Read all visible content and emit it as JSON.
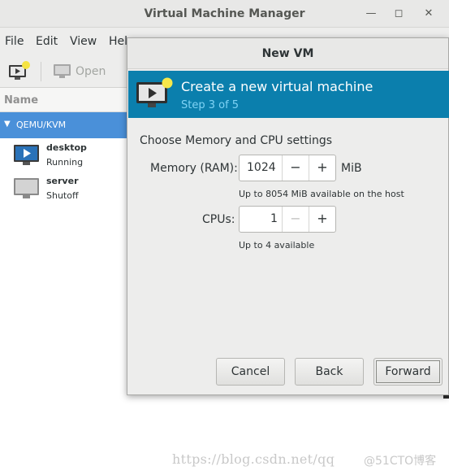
{
  "main_window": {
    "title": "Virtual Machine Manager",
    "controls": {
      "minimize": "—",
      "maximize": "◻",
      "close": "✕"
    },
    "menu": [
      "File",
      "Edit",
      "View",
      "Hel"
    ],
    "toolbar": {
      "open_label": "Open"
    },
    "list_header": "Name",
    "group": {
      "label": "QEMU/KVM",
      "expander": "▼"
    },
    "vms": [
      {
        "name": "desktop",
        "status": "Running",
        "icon": "vm-running-icon"
      },
      {
        "name": "server",
        "status": "Shutoff",
        "icon": "vm-shutoff-icon"
      }
    ]
  },
  "dialog": {
    "title": "New VM",
    "header": {
      "title": "Create a new virtual machine",
      "step": "Step 3 of 5"
    },
    "section_title": "Choose Memory and CPU settings",
    "memory": {
      "label": "Memory (RAM):",
      "value": "1024",
      "unit": "MiB",
      "hint": "Up to 8054 MiB available on the host",
      "minus": "−",
      "plus": "+"
    },
    "cpus": {
      "label": "CPUs:",
      "value": "1",
      "hint": "Up to 4 available",
      "minus": "−",
      "plus": "+"
    },
    "buttons": {
      "cancel": "Cancel",
      "back": "Back",
      "forward": "Forward"
    }
  },
  "watermark": {
    "url": "https://blog.csdn.net/qq",
    "brand": "@51CTO博客"
  },
  "colors": {
    "header_bg": "#0b7fad",
    "selection": "#4a90d9",
    "step_text": "#7fd3f5"
  }
}
